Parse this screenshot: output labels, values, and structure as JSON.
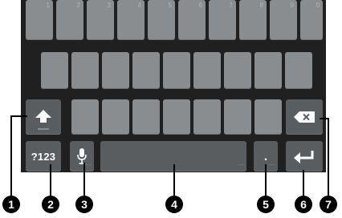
{
  "keyboard": {
    "number_row": [
      "1",
      "2",
      "3",
      "4",
      "5",
      "6",
      "7",
      "8",
      "9",
      "0"
    ],
    "symbols_label": "?123",
    "period_label": "."
  },
  "callouts": [
    "1",
    "2",
    "3",
    "4",
    "5",
    "6",
    "7"
  ],
  "icons": {
    "shift": "shift-arrow-icon",
    "microphone": "microphone-icon",
    "backspace": "backspace-icon",
    "enter": "enter-arrow-icon"
  },
  "colors": {
    "keyboard_bg": "#202020",
    "letter_key": "#8a8d90",
    "function_key": "#5a5d60",
    "callout": "#000000"
  }
}
